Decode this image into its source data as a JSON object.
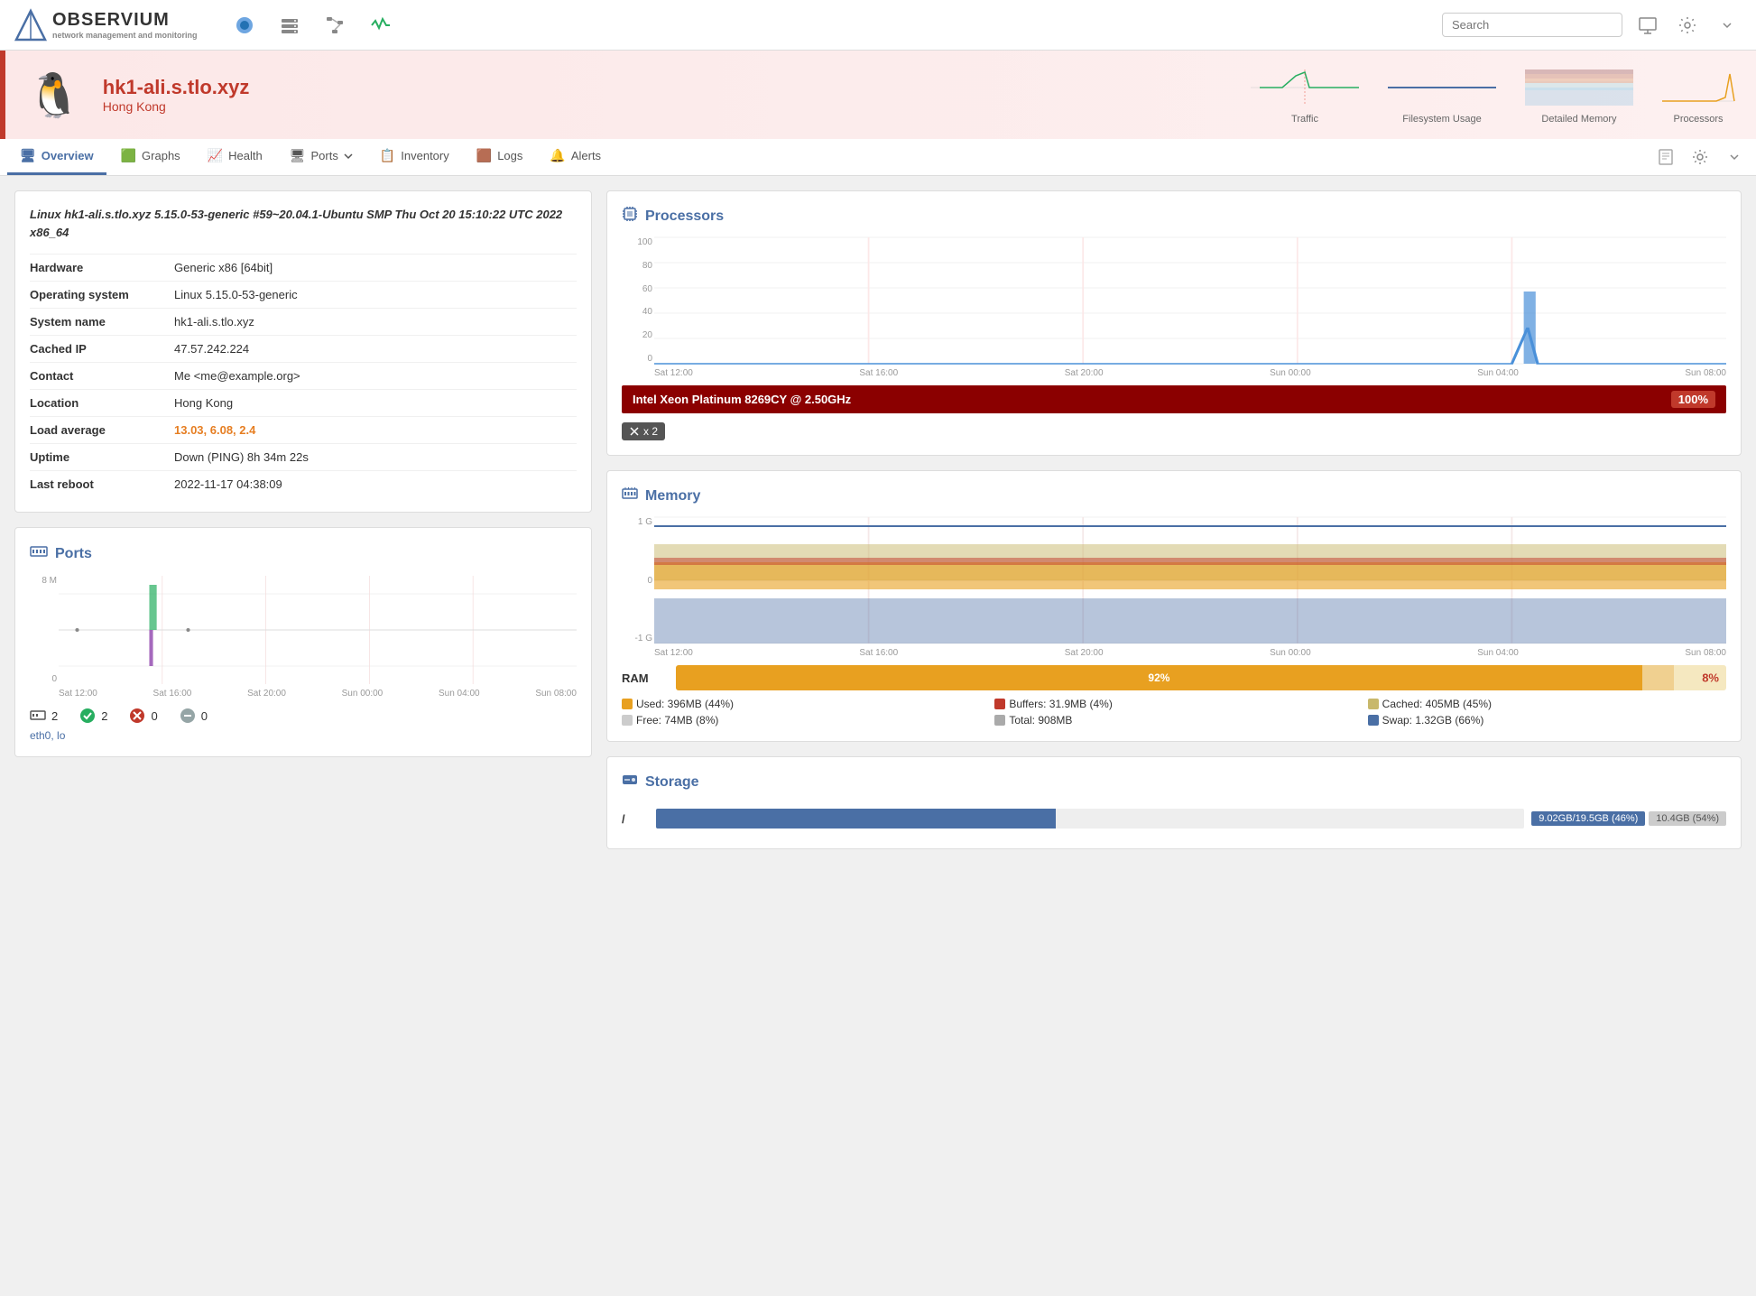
{
  "topnav": {
    "logo_name": "OBSERVIUM",
    "logo_sub": "network management and monitoring",
    "search_placeholder": "Search",
    "nav_icons": [
      "dashboard-icon",
      "server-icon",
      "network-icon",
      "activity-icon"
    ]
  },
  "device_banner": {
    "hostname": "hk1-ali.s.tlo.xyz",
    "location": "Hong Kong",
    "graphs": [
      {
        "label": "Traffic"
      },
      {
        "label": "Filesystem Usage"
      },
      {
        "label": "Detailed Memory"
      },
      {
        "label": "Processors"
      }
    ]
  },
  "tabs": [
    {
      "label": "Overview",
      "active": true
    },
    {
      "label": "Graphs"
    },
    {
      "label": "Health"
    },
    {
      "label": "Ports"
    },
    {
      "label": "Inventory"
    },
    {
      "label": "Logs"
    },
    {
      "label": "Alerts"
    }
  ],
  "device_details": {
    "description": "Linux hk1-ali.s.tlo.xyz 5.15.0-53-generic #59~20.04.1-Ubuntu SMP Thu Oct 20 15:10:22 UTC 2022 x86_64",
    "fields": [
      {
        "label": "Hardware",
        "value": "Generic x86 [64bit]"
      },
      {
        "label": "Operating system",
        "value": "Linux 5.15.0-53-generic"
      },
      {
        "label": "System name",
        "value": "hk1-ali.s.tlo.xyz"
      },
      {
        "label": "Cached IP",
        "value": "47.57.242.224"
      },
      {
        "label": "Contact",
        "value": "Me <me@example.org>"
      },
      {
        "label": "Location",
        "value": "Hong Kong"
      },
      {
        "label": "Load average",
        "value": "13.03, 6.08, 2.4",
        "highlight": true
      },
      {
        "label": "Uptime",
        "value": "Down (PING) 8h 34m 22s"
      },
      {
        "label": "Last reboot",
        "value": "2022-11-17 04:38:09"
      }
    ]
  },
  "ports_section": {
    "title": "Ports",
    "stats": [
      {
        "icon": "server",
        "count": 2,
        "color": "#555"
      },
      {
        "icon": "check",
        "count": 2,
        "color": "#27ae60"
      },
      {
        "icon": "minus",
        "count": 0,
        "color": "#c0392b"
      },
      {
        "icon": "circle",
        "count": 0,
        "color": "#95a5a6"
      }
    ],
    "interfaces": "eth0, lo",
    "x_labels": [
      "Sat 12:00",
      "Sat 16:00",
      "Sat 20:00",
      "Sun 00:00",
      "Sun 04:00",
      "Sun 08:00"
    ],
    "y_label": "8 M",
    "y_zero": "0"
  },
  "processors_section": {
    "title": "Processors",
    "x_labels": [
      "Sat 12:00",
      "Sat 16:00",
      "Sat 20:00",
      "Sun 00:00",
      "Sun 04:00",
      "Sun 08:00"
    ],
    "y_labels": [
      "100",
      "80",
      "60",
      "40",
      "20",
      "0"
    ],
    "cpu_bar": {
      "name": "Intel Xeon Platinum 8269CY @ 2.50GHz",
      "percentage": "100%",
      "multiplier": "x 2"
    }
  },
  "memory_section": {
    "title": "Memory",
    "x_labels": [
      "Sat 12:00",
      "Sat 16:00",
      "Sat 20:00",
      "Sun 00:00",
      "Sun 04:00",
      "Sun 08:00"
    ],
    "y_labels": [
      "1 G",
      "0",
      "-1 G"
    ],
    "ram": {
      "label": "RAM",
      "used_pct": 92,
      "free_pct": 8,
      "used_label": "92%",
      "free_label": "8%"
    },
    "legend": [
      {
        "label": "Used: 396MB (44%)",
        "color": "#e8a020"
      },
      {
        "label": "Buffers: 31.9MB (4%)",
        "color": "#c0392b"
      },
      {
        "label": "Cached: 405MB (45%)",
        "color": "#c8b86b"
      },
      {
        "label": "Free: 74MB (8%)",
        "color": "#ccc"
      },
      {
        "label": "Total: 908MB",
        "color": "#aaa"
      },
      {
        "label": "Swap: 1.32GB (66%)",
        "color": "#4a6fa5"
      }
    ]
  },
  "storage_section": {
    "title": "Storage",
    "items": [
      {
        "path": "/",
        "used_label": "9.02GB/19.5GB (46%)",
        "free_label": "10.4GB (54%)",
        "used_pct": 46
      }
    ]
  }
}
